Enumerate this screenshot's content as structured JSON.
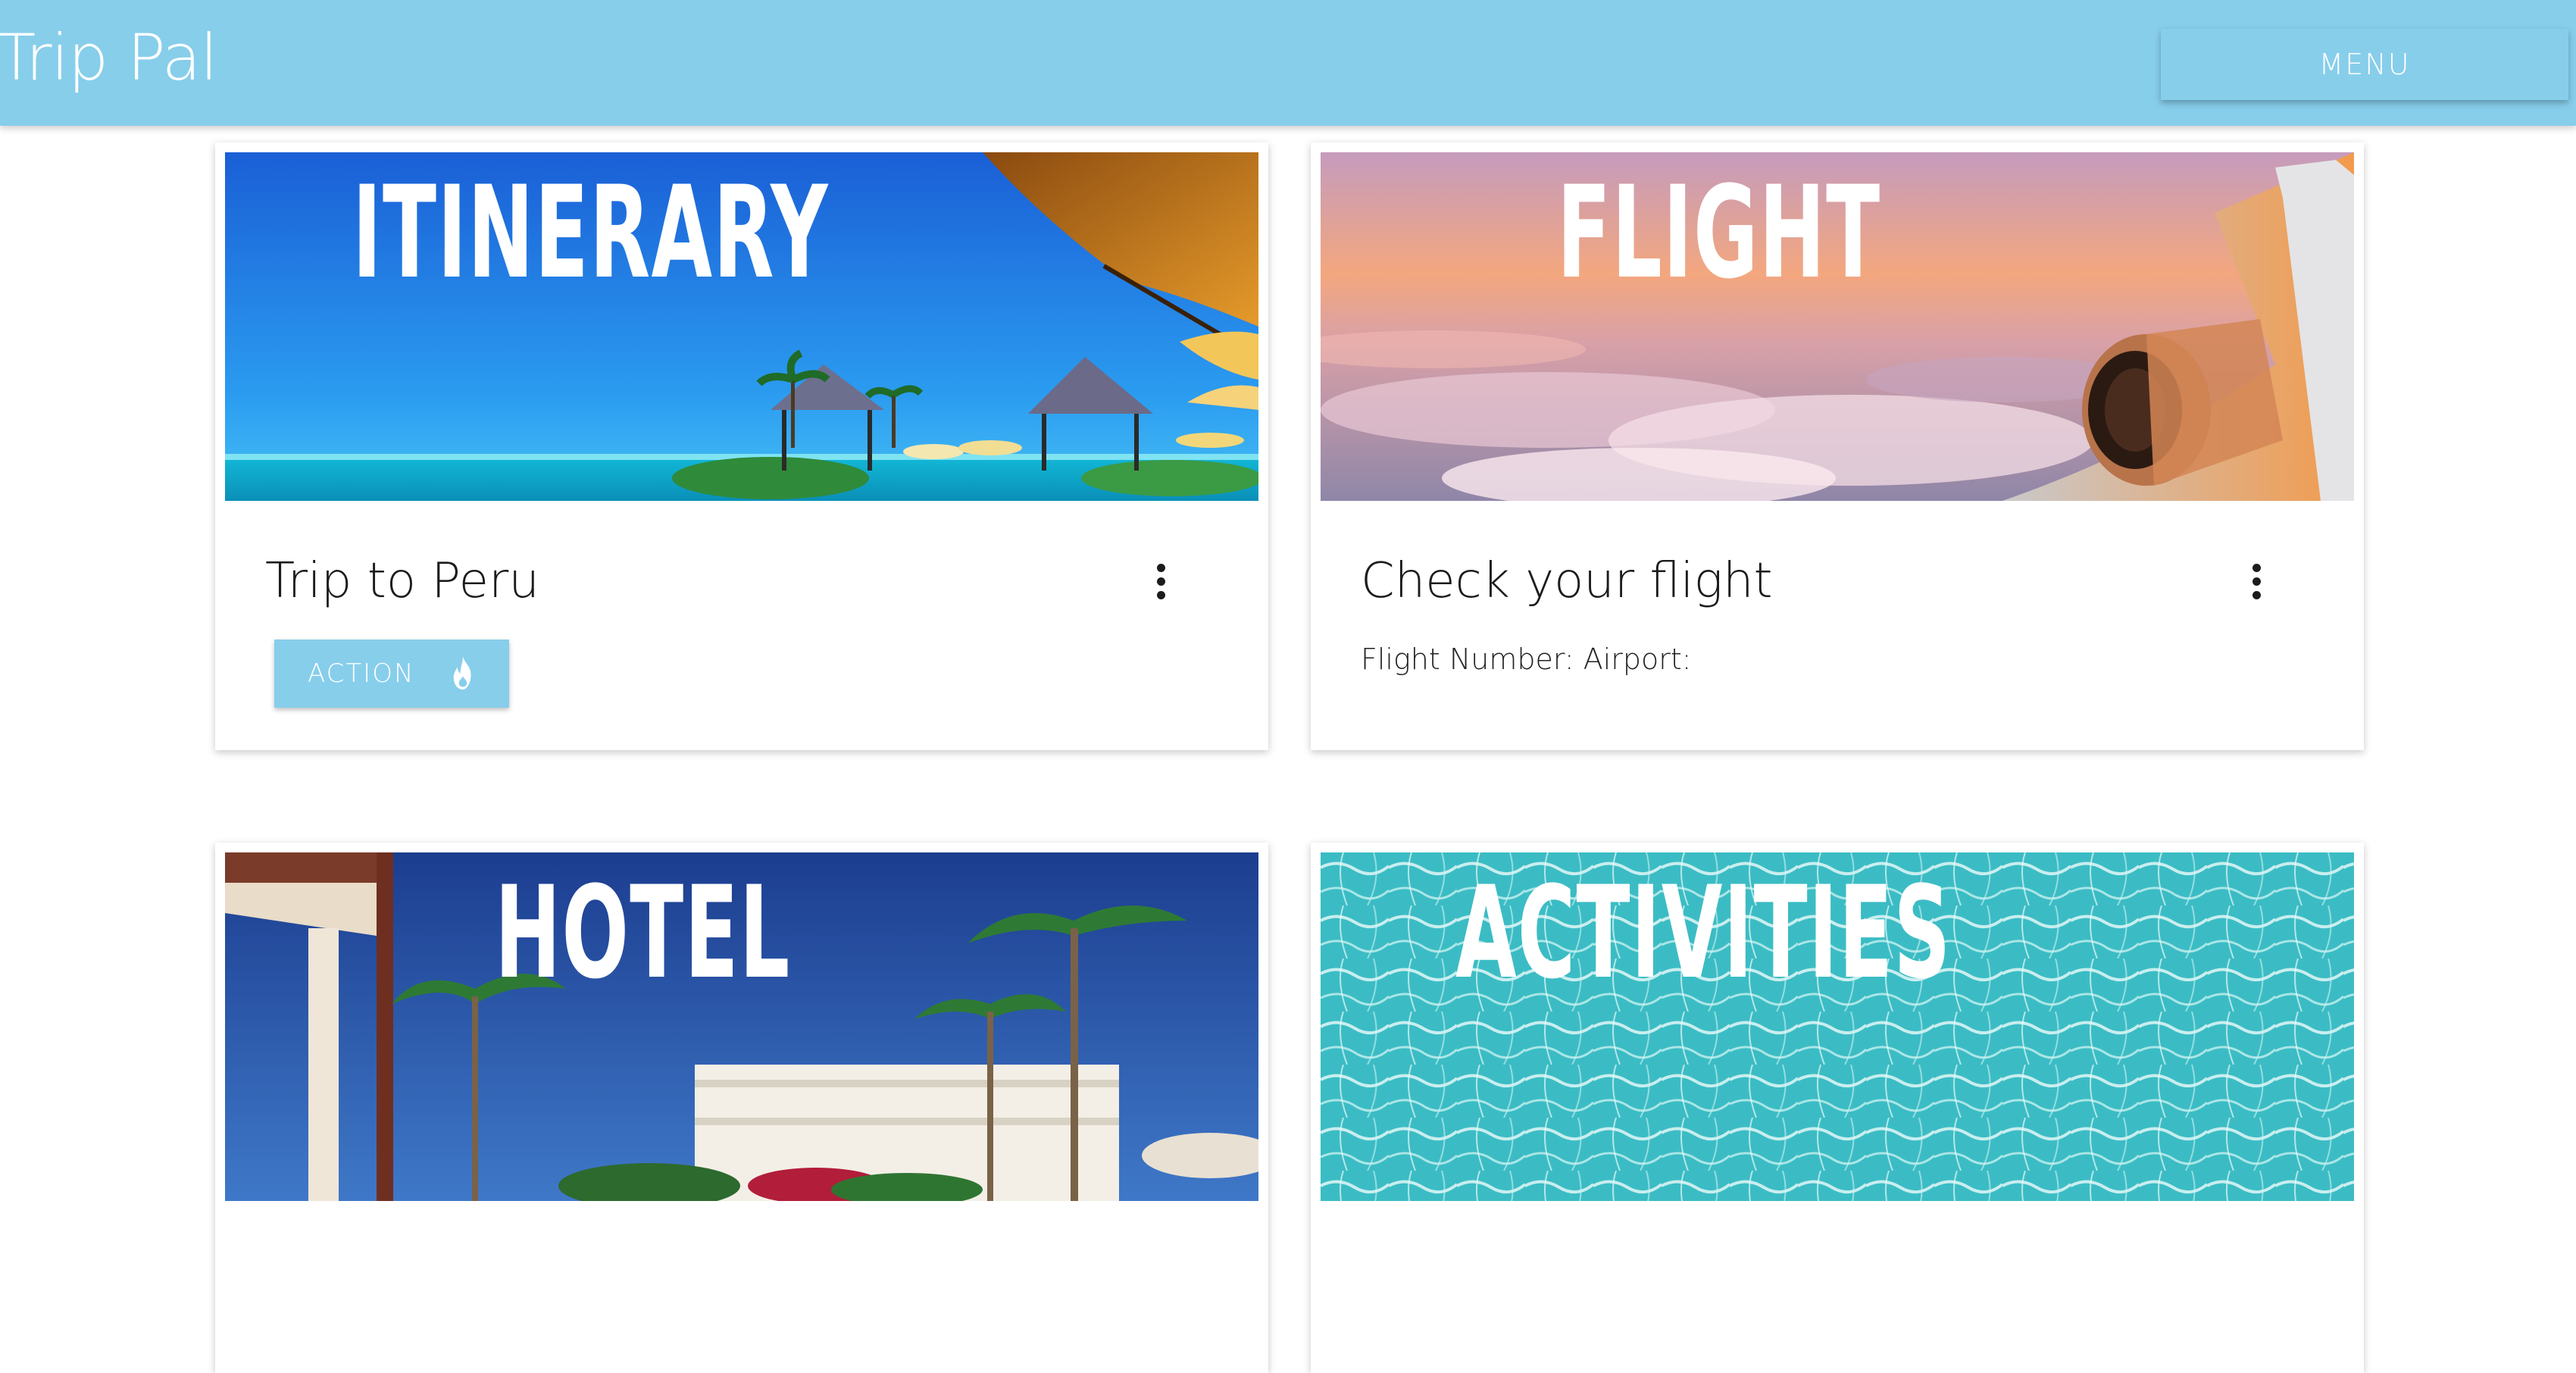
{
  "header": {
    "brand": "Trip Pal",
    "menu_label": "MENU",
    "bar_color": "#87ceeb"
  },
  "cards": {
    "itinerary": {
      "media_title": "ITINERARY",
      "title": "Trip to Peru",
      "action_label": "ACTION",
      "action_icon": "fire-icon",
      "more_icon": "more-vert-icon"
    },
    "flight": {
      "media_title": "FLIGHT",
      "title": "Check your flight",
      "details": "Flight Number: Airport:",
      "more_icon": "more-vert-icon"
    },
    "hotel": {
      "media_title": "HOTEL"
    },
    "activities": {
      "media_title": "ACTIVITIES"
    }
  }
}
